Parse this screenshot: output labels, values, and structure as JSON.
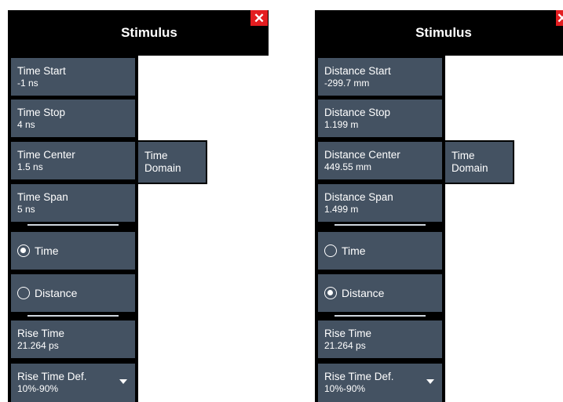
{
  "panels": {
    "left": {
      "title": "Stimulus",
      "close_icon": "close-icon",
      "buttons": [
        {
          "label": "Time Start",
          "value": "-1 ns"
        },
        {
          "label": "Time Stop",
          "value": "4 ns"
        },
        {
          "label": "Time Center",
          "value": "1.5 ns"
        },
        {
          "label": "Time Span",
          "value": "5 ns"
        }
      ],
      "radios": [
        {
          "label": "Time",
          "selected": true
        },
        {
          "label": "Distance",
          "selected": false
        }
      ],
      "rise_time": {
        "label": "Rise Time",
        "value": "21.264 ps"
      },
      "rise_time_def": {
        "label": "Rise Time Def.",
        "value": "10%-90%"
      },
      "side_tab": {
        "line1": "Time",
        "line2": "Domain"
      }
    },
    "right": {
      "title": "Stimulus",
      "close_icon": "close-icon",
      "buttons": [
        {
          "label": "Distance Start",
          "value": "-299.7 mm"
        },
        {
          "label": "Distance Stop",
          "value": "1.199 m"
        },
        {
          "label": "Distance Center",
          "value": "449.55 mm"
        },
        {
          "label": "Distance Span",
          "value": "1.499 m"
        }
      ],
      "radios": [
        {
          "label": "Time",
          "selected": false
        },
        {
          "label": "Distance",
          "selected": true
        }
      ],
      "rise_time": {
        "label": "Rise Time",
        "value": "21.264 ps"
      },
      "rise_time_def": {
        "label": "Rise Time Def.",
        "value": "10%-90%"
      },
      "side_tab": {
        "line1": "Time",
        "line2": "Domain"
      }
    }
  },
  "colors": {
    "panel_bg": "#000000",
    "button_bg": "#445262",
    "close_bg": "#e31d20",
    "text": "#ffffff"
  }
}
